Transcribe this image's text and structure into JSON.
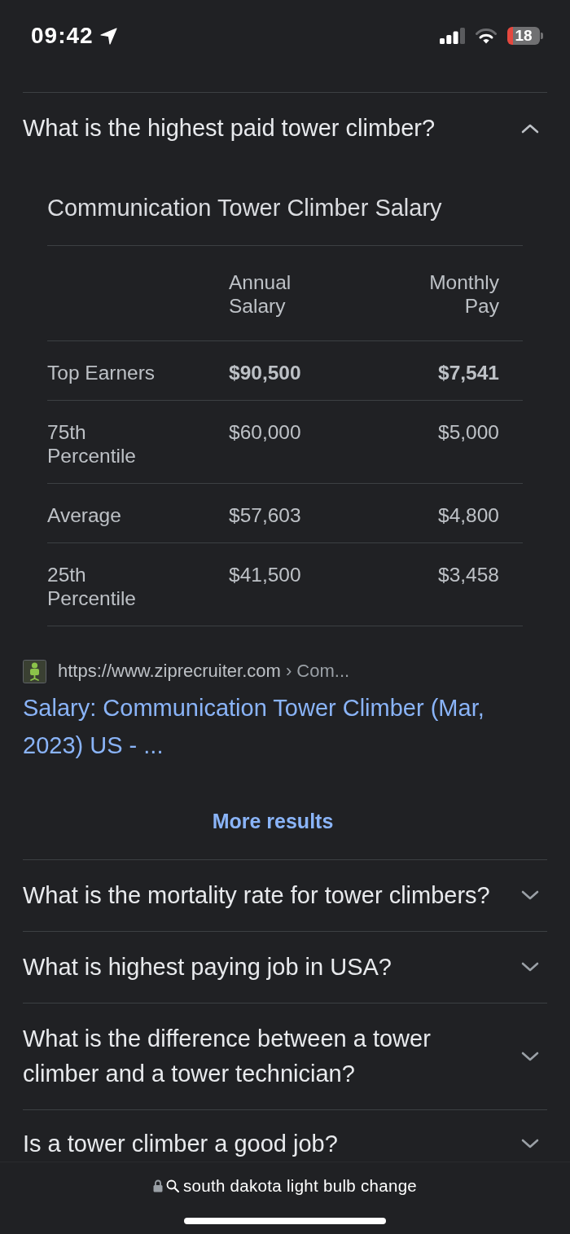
{
  "status_bar": {
    "time": "09:42",
    "battery": "18"
  },
  "faq": [
    {
      "question": "What is the highest paid tower climber?",
      "expanded": true,
      "answer": {
        "title": "Communication Tower Climber Salary",
        "table": {
          "columns": [
            "Annual Salary",
            "Monthly Pay"
          ],
          "rows": [
            {
              "label": "Top Earners",
              "values": [
                "$90,500",
                "$7,541"
              ],
              "bold": true
            },
            {
              "label": "75th Percentile",
              "values": [
                "$60,000",
                "$5,000"
              ],
              "bold": false
            },
            {
              "label": "Average",
              "values": [
                "$57,603",
                "$4,800"
              ],
              "bold": false
            },
            {
              "label": "25th Percentile",
              "values": [
                "$41,500",
                "$3,458"
              ],
              "bold": false
            }
          ]
        },
        "source": {
          "url": "https://www.ziprecruiter.com",
          "breadcrumb": "› Com...",
          "title": "Salary: Communication Tower Climber (Mar, 2023) US - ..."
        },
        "more_results": "More results"
      }
    },
    {
      "question": "What is the mortality rate for tower climbers?",
      "expanded": false
    },
    {
      "question": "What is highest paying job in USA?",
      "expanded": false
    },
    {
      "question": "What is the difference between a tower climber and a tower technician?",
      "expanded": false
    },
    {
      "question": "Is a tower climber a good job?",
      "expanded": false
    }
  ],
  "address_bar": {
    "text": "south dakota light bulb change"
  }
}
